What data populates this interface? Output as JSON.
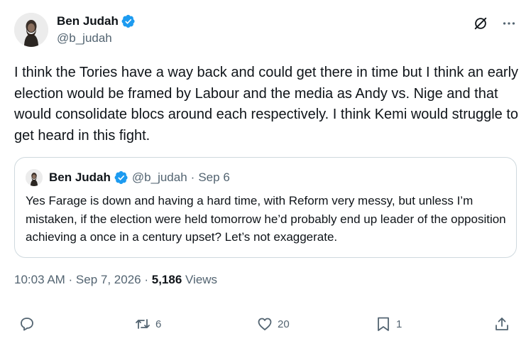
{
  "author": {
    "name": "Ben Judah",
    "handle": "@b_judah"
  },
  "tweet": {
    "text": "I think the Tories have a way back and could get there in time but I think an early election would be framed by Labour and the media as Andy vs. Nige and that would consolidate blocs around each respectively. I think Kemi would struggle to get heard in this fight.",
    "timestamp": "10:03 AM · Sep 7, 2026 · ",
    "views_count": "5,186",
    "views_label": " Views"
  },
  "quoted": {
    "name": "Ben Judah",
    "handle": "@b_judah",
    "separator": "·",
    "date": "Sep 6",
    "text": "Yes Farage is down and having a hard time, with Reform very messy, but unless I’m mistaken, if the election were held tomorrow he’d probably end up leader of the opposition achieving a once in a century upset? Let’s not exaggerate."
  },
  "actions": {
    "reply": "",
    "retweet": "6",
    "like": "20",
    "bookmark": "1"
  },
  "colors": {
    "text": "#0f1419",
    "secondary": "#536471",
    "verified": "#1d9bf0",
    "border": "#cfd9de"
  },
  "icons": [
    "grok-icon",
    "more-icon",
    "reply-icon",
    "retweet-icon",
    "like-icon",
    "bookmark-icon",
    "share-icon",
    "verified-badge-icon"
  ]
}
